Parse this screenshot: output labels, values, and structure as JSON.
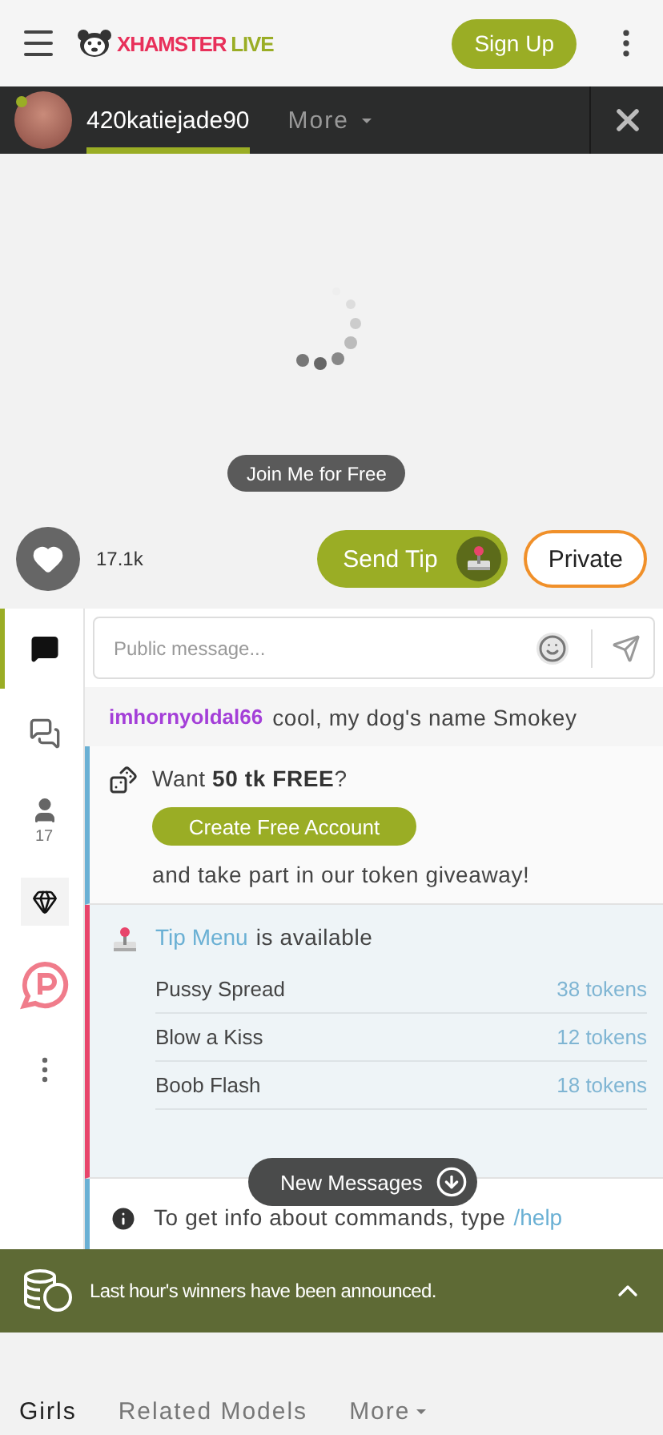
{
  "header": {
    "logo": {
      "part_1": "XHAMSTER",
      "part_2": "LIVE"
    },
    "sign_up": "Sign Up"
  },
  "model_bar": {
    "online": true,
    "tabs": [
      {
        "kind": "profile",
        "label": "420katiejade90",
        "selected": true
      },
      {
        "kind": "dropdown",
        "label": "More",
        "selected": false
      }
    ]
  },
  "video": {
    "join_button": "Join Me for Free"
  },
  "actions": {
    "likes": "17.1k",
    "send_tip": "Send Tip",
    "private": "Private"
  },
  "sidebar": {
    "items": [
      {
        "kind": "chat",
        "selected": true
      },
      {
        "kind": "messages",
        "selected": false
      },
      {
        "kind": "users",
        "selected": false,
        "count": "17"
      },
      {
        "kind": "diamond",
        "selected": false
      },
      {
        "kind": "p",
        "selected": false
      },
      {
        "kind": "more",
        "selected": false
      }
    ]
  },
  "chat": {
    "input": {
      "placeholder": "Public message..."
    },
    "messages": [
      {
        "kind": "user",
        "user": "imhornyoldal66",
        "color": "#a43fd8",
        "text": "cool, my dog's name Smokey"
      },
      {
        "kind": "promo",
        "text": "Want **50 tk FREE**?",
        "button": "Create Free Account",
        "footer": "and take part in our token giveaway!"
      },
      {
        "kind": "tip_menu",
        "link": "Tip Menu",
        "text": "is available",
        "items": [
          {
            "name": "Pussy Spread",
            "price": "38 tokens"
          },
          {
            "name": "Blow a Kiss",
            "price": "12 tokens"
          },
          {
            "name": "Boob Flash",
            "price": "18 tokens"
          }
        ]
      },
      {
        "kind": "info",
        "text": "To get info about commands, type",
        "link": "/help"
      }
    ],
    "new_messages": "New Messages"
  },
  "banner": {
    "text": "Last hour's winners have been announced."
  },
  "bottom_tabs": [
    {
      "label": "Girls",
      "selected": true,
      "kind": "plain"
    },
    {
      "label": "Related Models",
      "selected": false,
      "kind": "plain"
    },
    {
      "label": "More",
      "selected": false,
      "kind": "dropdown"
    }
  ]
}
